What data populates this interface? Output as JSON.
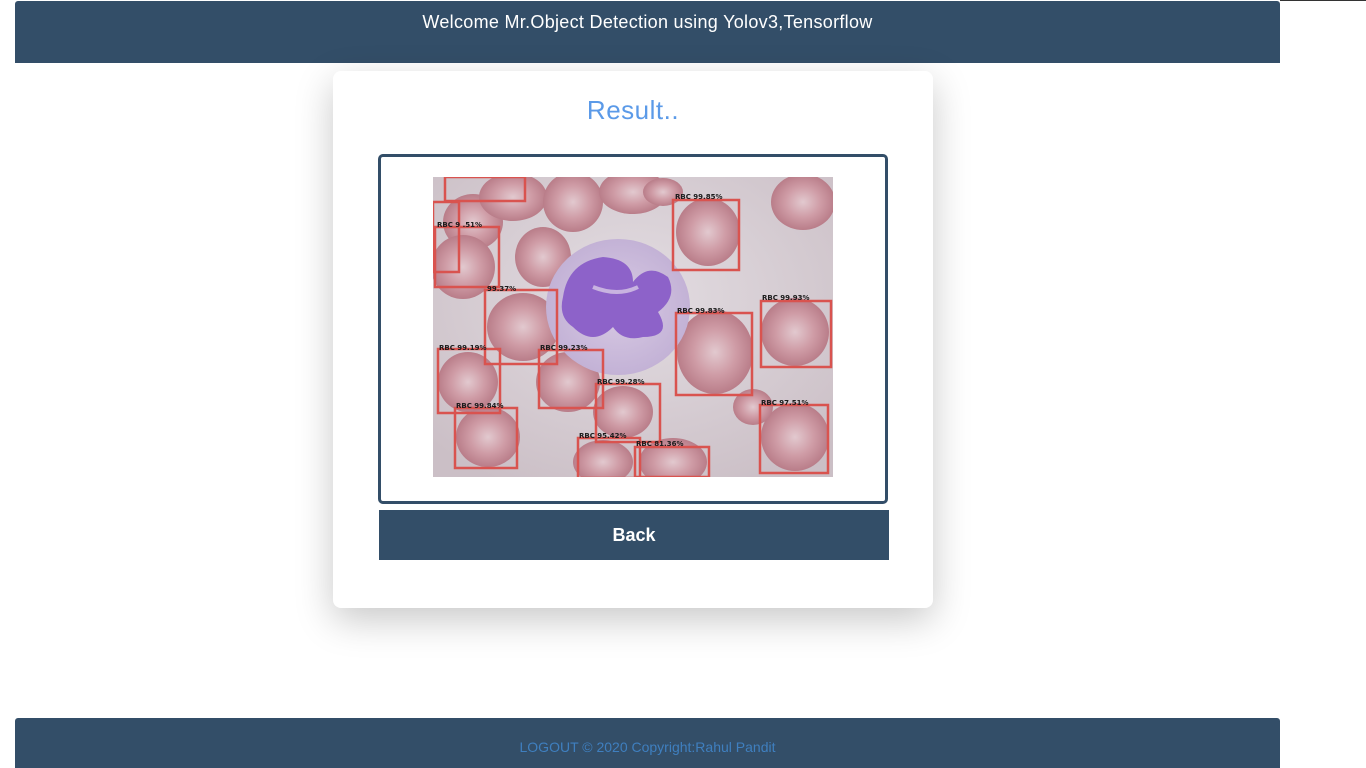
{
  "header": {
    "title": "Welcome Mr.Object Detection using Yolov3,Tensorflow"
  },
  "result": {
    "title": "Result..",
    "image_alt": "Blood smear with RBC detections",
    "detections": [
      {
        "label": "RBC 99.85%"
      },
      {
        "label": "RBC 9 .51%"
      },
      {
        "label": "99.37%"
      },
      {
        "label": "RBC 99.83%"
      },
      {
        "label": "RBC 99.93%"
      },
      {
        "label": "RBC 99.19%"
      },
      {
        "label": "RBC 99.23%"
      },
      {
        "label": "RBC 99.28%"
      },
      {
        "label": "RBC 99.84%"
      },
      {
        "label": "RBC 97.51%"
      },
      {
        "label": "RBC 95.42%"
      },
      {
        "label": "RBC 81.36%"
      }
    ]
  },
  "buttons": {
    "back": "Back"
  },
  "footer": {
    "logout": "LOGOUT",
    "copyright": " © 2020 Copyright:Rahul Pandit"
  },
  "colors": {
    "primary": "#334e68",
    "accent_title": "#5b9ae8",
    "footer_text": "#3f7fbf",
    "box": "#d9534f"
  }
}
